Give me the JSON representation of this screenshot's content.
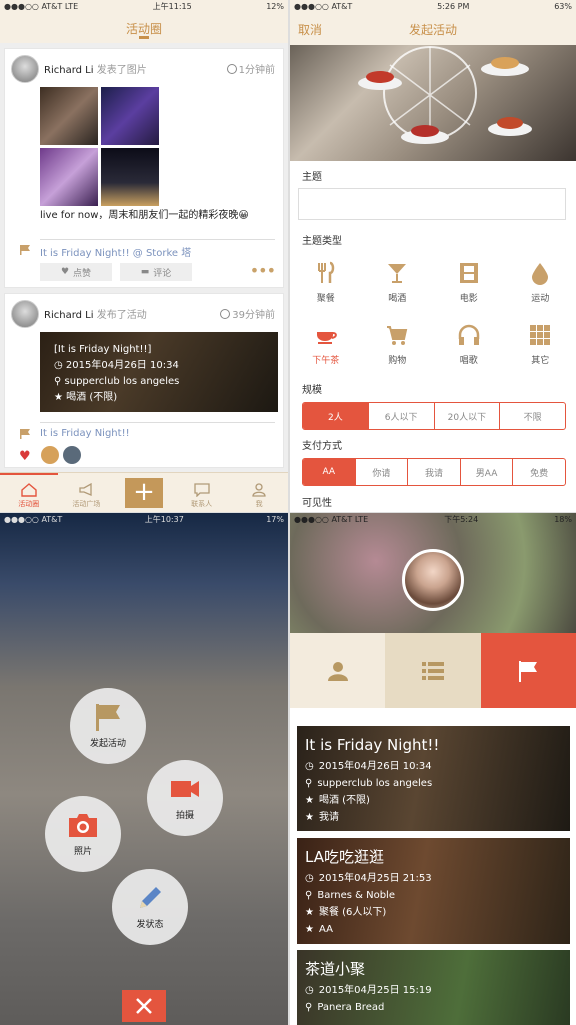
{
  "feed": {
    "status": {
      "carrier": "●●●○○ AT&T  LTE",
      "time": "上午11:15",
      "battery": "12%"
    },
    "title": "活动圈",
    "post1": {
      "user": "Richard Li",
      "action": "发表了图片",
      "time": "1分钟前",
      "text": "live for now，周末和朋友们一起的精彩夜晚😀",
      "tag": "It is Friday Night!! @ Storke 塔",
      "like": "点赞",
      "comment": "评论"
    },
    "post2": {
      "user": "Richard Li",
      "action": "发布了活动",
      "time": "39分钟前",
      "event_title": "[It is Friday Night!!]",
      "event_date": "2015年04月26日 10:34",
      "event_place": "supperclub los angeles",
      "event_type": "喝酒 (不限)",
      "tag": "It is Friday Night!!"
    },
    "tabs": [
      "活动圈",
      "活动广场",
      "",
      "联系人",
      "我"
    ]
  },
  "create": {
    "status": {
      "carrier": "●●●○○ AT&T",
      "time": "5:26 PM",
      "battery": "63%"
    },
    "cancel": "取消",
    "title": "发起活动",
    "topic_label": "主题",
    "type_label": "主题类型",
    "types": [
      "聚餐",
      "喝酒",
      "电影",
      "运动",
      "下午茶",
      "购物",
      "唱歌",
      "其它"
    ],
    "scale_label": "规模",
    "scale": [
      "2人",
      "6人以下",
      "20人以下",
      "不限"
    ],
    "pay_label": "支付方式",
    "pay": [
      "AA",
      "你请",
      "我请",
      "男AA",
      "免费"
    ],
    "visibility_label": "可见性",
    "accent": "#e4553e"
  },
  "menu": {
    "status": {
      "carrier": "●●●○○ AT&T",
      "time": "上午10:37",
      "battery": "17%"
    },
    "items": [
      "发起活动",
      "拍摄",
      "照片",
      "发状态"
    ]
  },
  "profile": {
    "status": {
      "carrier": "●●●○○ AT&T  LTE",
      "time": "下午5:24",
      "battery": "18%"
    },
    "events": [
      {
        "title": "It is Friday Night!!",
        "date": "2015年04月26日 10:34",
        "place": "supperclub los angeles",
        "type": "喝酒 (不限)",
        "pay": "我请"
      },
      {
        "title": "LA吃吃逛逛",
        "date": "2015年04月25日 21:53",
        "place": "Barnes & Noble",
        "type": "聚餐 (6人以下)",
        "pay": "AA"
      },
      {
        "title": "茶道小聚",
        "date": "2015年04月25日 15:19",
        "place": "Panera Bread"
      }
    ]
  }
}
